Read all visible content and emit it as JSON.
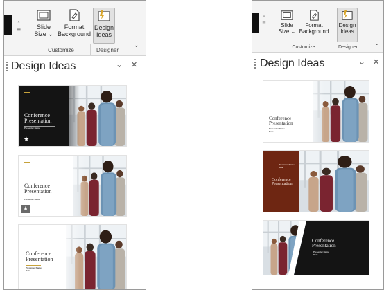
{
  "ribbon": {
    "slide_size": "Slide\nSize ⌄",
    "format_background": "Format\nBackground",
    "design_ideas": "Design\nIdeas",
    "customize_group": "Customize",
    "designer_group": "Designer"
  },
  "pane": {
    "title": "Design Ideas"
  },
  "thumbnails": {
    "conference_title": "Conference\nPresentation",
    "presenter": "Presenter Name",
    "presenter_date": "Presenter Name\nDate"
  },
  "colors": {
    "accent_gold": "#c6a23b",
    "dark_slide": "#141414",
    "rust_slide": "#6e2612"
  },
  "icons": [
    "slide-size-icon",
    "format-background-icon",
    "design-ideas-icon",
    "chevron-down-icon",
    "close-icon",
    "star-icon"
  ]
}
